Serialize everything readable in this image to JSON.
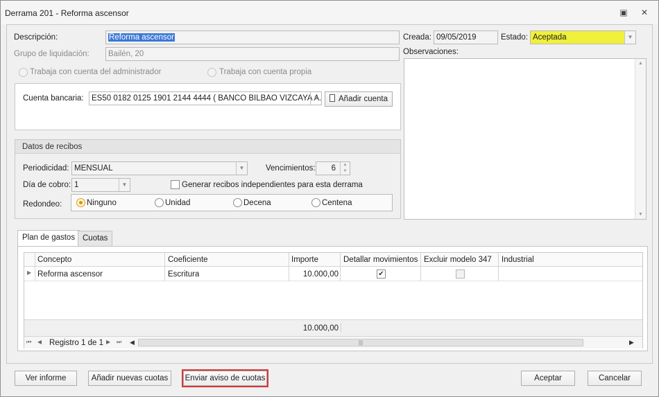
{
  "window": {
    "title": "Derrama 201 - Reforma ascensor",
    "restore_glyph": "▣",
    "close_glyph": "✕"
  },
  "form": {
    "descripcion_label": "Descripción:",
    "descripcion_value": "Reforma ascensor",
    "grupo_label": "Grupo de liquidación:",
    "grupo_value": "Bailén, 20",
    "radio_admin_label": "Trabaja con cuenta del administrador",
    "radio_propia_label": "Trabaja con cuenta propia",
    "creada_label": "Creada:",
    "creada_value": "09/05/2019",
    "estado_label": "Estado:",
    "estado_value": "Aceptada",
    "estado_color": "#f0f03c",
    "observaciones_label": "Observaciones:"
  },
  "bank": {
    "cuenta_label": "Cuenta bancaria:",
    "cuenta_value": "ES50 0182 0125 1901 2144 4444 ( BANCO BILBAO VIZCAYA A...",
    "add_button": "Añadir cuenta"
  },
  "recibos": {
    "header": "Datos de recibos",
    "periodicidad_label": "Periodicidad:",
    "periodicidad_value": "MENSUAL",
    "vencimientos_label": "Vencimientos:",
    "vencimientos_value": "6",
    "dia_cobro_label": "Día de cobro:",
    "dia_cobro_value": "1",
    "generar_label": "Generar recibos independientes para esta derrama",
    "redondeo_label": "Redondeo:",
    "redondeo_options": [
      "Ninguno",
      "Unidad",
      "Decena",
      "Centena"
    ],
    "redondeo_selected": "Ninguno"
  },
  "tabs": [
    "Plan de gastos",
    "Cuotas"
  ],
  "grid": {
    "columns": [
      "Concepto",
      "Coeficiente",
      "Importe",
      "Detallar movimientos",
      "Excluir modelo 347",
      "Industrial"
    ],
    "rows": [
      {
        "concepto": "Reforma ascensor",
        "coeficiente": "Escritura",
        "importe": "10.000,00",
        "detallar": true,
        "excluir": false,
        "industrial": ""
      }
    ],
    "total_importe": "10.000,00",
    "navigator_text": "Registro 1 de 1"
  },
  "footer": {
    "ver_informe": "Ver informe",
    "nuevas_cuotas": "Añadir nuevas cuotas",
    "enviar_aviso": "Enviar aviso de cuotas",
    "aceptar": "Aceptar",
    "cancelar": "Cancelar"
  }
}
